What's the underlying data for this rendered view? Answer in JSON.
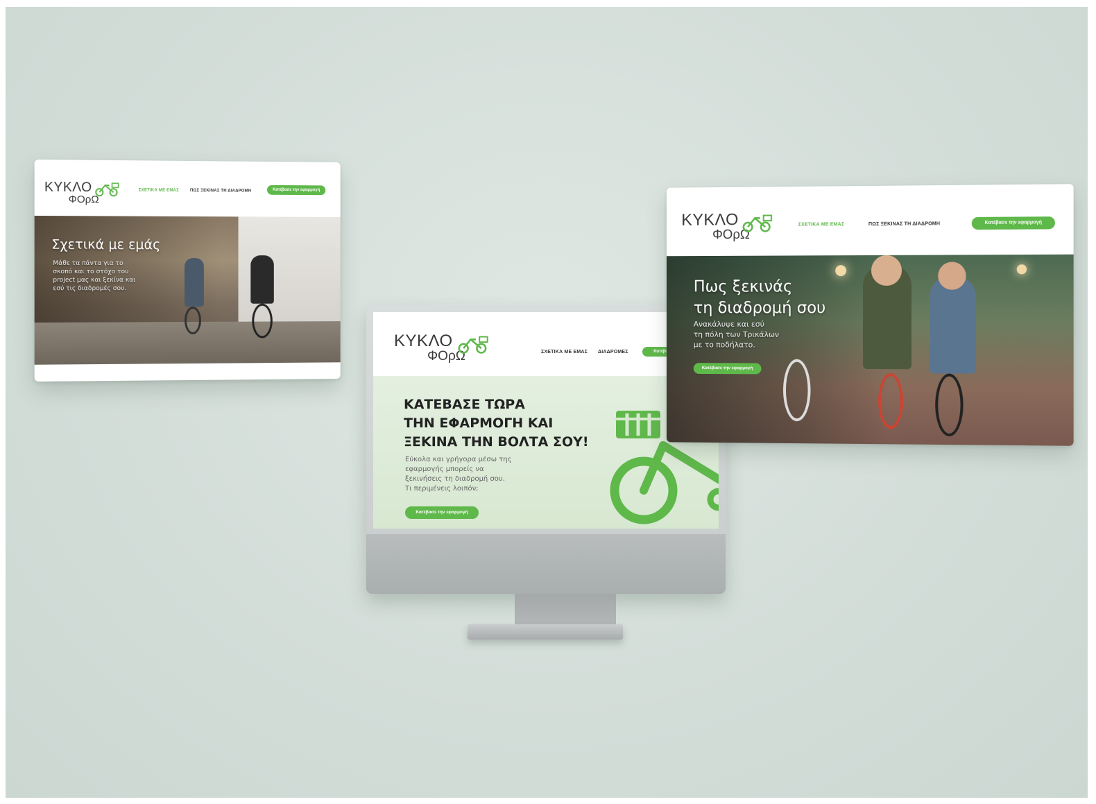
{
  "brand": {
    "logo_line1": "ΚΥΚΛΟ",
    "logo_line2": "ΦΟρΩ",
    "accent_color": "#5fb84a"
  },
  "card_about": {
    "nav": {
      "link1": "ΣΧΕΤΙΚΑ ΜΕ ΕΜΑΣ",
      "link2": "ΠΩΣ ΞΕΚΙΝΑΣ ΤΗ ΔΙΑΔΡΟΜΗ",
      "cta": "Κατέβασε την εφαρμογή"
    },
    "hero_title": "Σχετικά με εμάς",
    "hero_text": [
      "Μάθε τα πάντα για το",
      "σκοπό και το στόχο του",
      "project μας και ξεκίνα και",
      "εσύ τις διαδρομές σου."
    ]
  },
  "card_monitor": {
    "nav": {
      "link1": "ΣΧΕΤΙΚΑ ΜΕ ΕΜΑΣ",
      "link2": "ΔΙΑΔΡΟΜΕΣ",
      "cta": "Κατέβασε"
    },
    "headline": [
      "ΚΑΤΕΒΑΣΕ ΤΩΡΑ",
      "ΤΗΝ ΕΦΑΡΜΟΓΗ ΚΑΙ",
      "ΞΕΚΙΝΑ ΤΗΝ ΒΟΛΤΑ ΣΟΥ!"
    ],
    "subtext": [
      "Εύκολα και γρήγορα μέσω της",
      "εφαρμογής μπορείς να",
      "ξεκινήσεις τη διαδρομή σου.",
      "Τι περιμένεις λοιπόν;"
    ],
    "cta": "Κατέβασε την εφαρμογή",
    "illustration": "bicycle-basket-icon"
  },
  "card_route": {
    "nav": {
      "link1": "ΣΧΕΤΙΚΑ ΜΕ ΕΜΑΣ",
      "link2": "ΠΩΣ ΞΕΚΙΝΑΣ ΤΗ ΔΙΑΔΡΟΜΗ",
      "cta": "Κατέβασε την εφαρμογή"
    },
    "hero_title": [
      "Πως ξεκινάς",
      "τη διαδρομή σου"
    ],
    "hero_text": [
      "Ανακάλυψε και εσύ",
      "τη πόλη των Τρικάλων",
      "με το ποδήλατο."
    ],
    "cta": "Κατέβασε την εφαρμογή"
  }
}
